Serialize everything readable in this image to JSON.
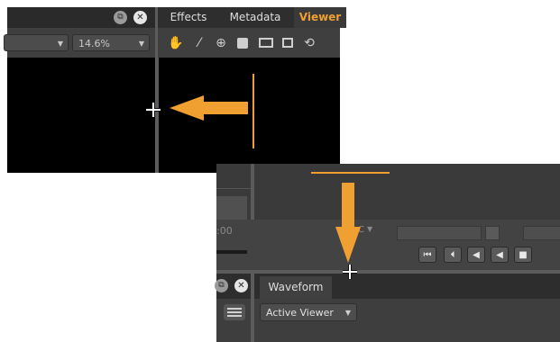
{
  "top_panel": {
    "tabs": [
      {
        "label": "Effects"
      },
      {
        "label": "Metadata"
      },
      {
        "label": "Viewer",
        "active": true
      }
    ],
    "window_icons": [
      "float-icon",
      "close-icon"
    ],
    "zoom": "14.6%",
    "tools": [
      "hand-icon",
      "eyedropper-icon",
      "zoom-icon",
      "save-frame-icon",
      "overlay-icon",
      "crop-icon",
      "refresh-icon"
    ]
  },
  "bottom_panel": {
    "timecode_fragment": ":00",
    "tc_label": "C",
    "waveform_tab": "Waveform",
    "active_viewer_dropdown": "Active Viewer",
    "transport": [
      "go-to-start-icon",
      "previous-frame-icon",
      "play-reverse-icon",
      "step-back-icon",
      "stop-icon"
    ]
  },
  "colors": {
    "accent": "#f0a030",
    "panel_bg": "#3d3d3d",
    "viewer_bg": "#000000"
  }
}
